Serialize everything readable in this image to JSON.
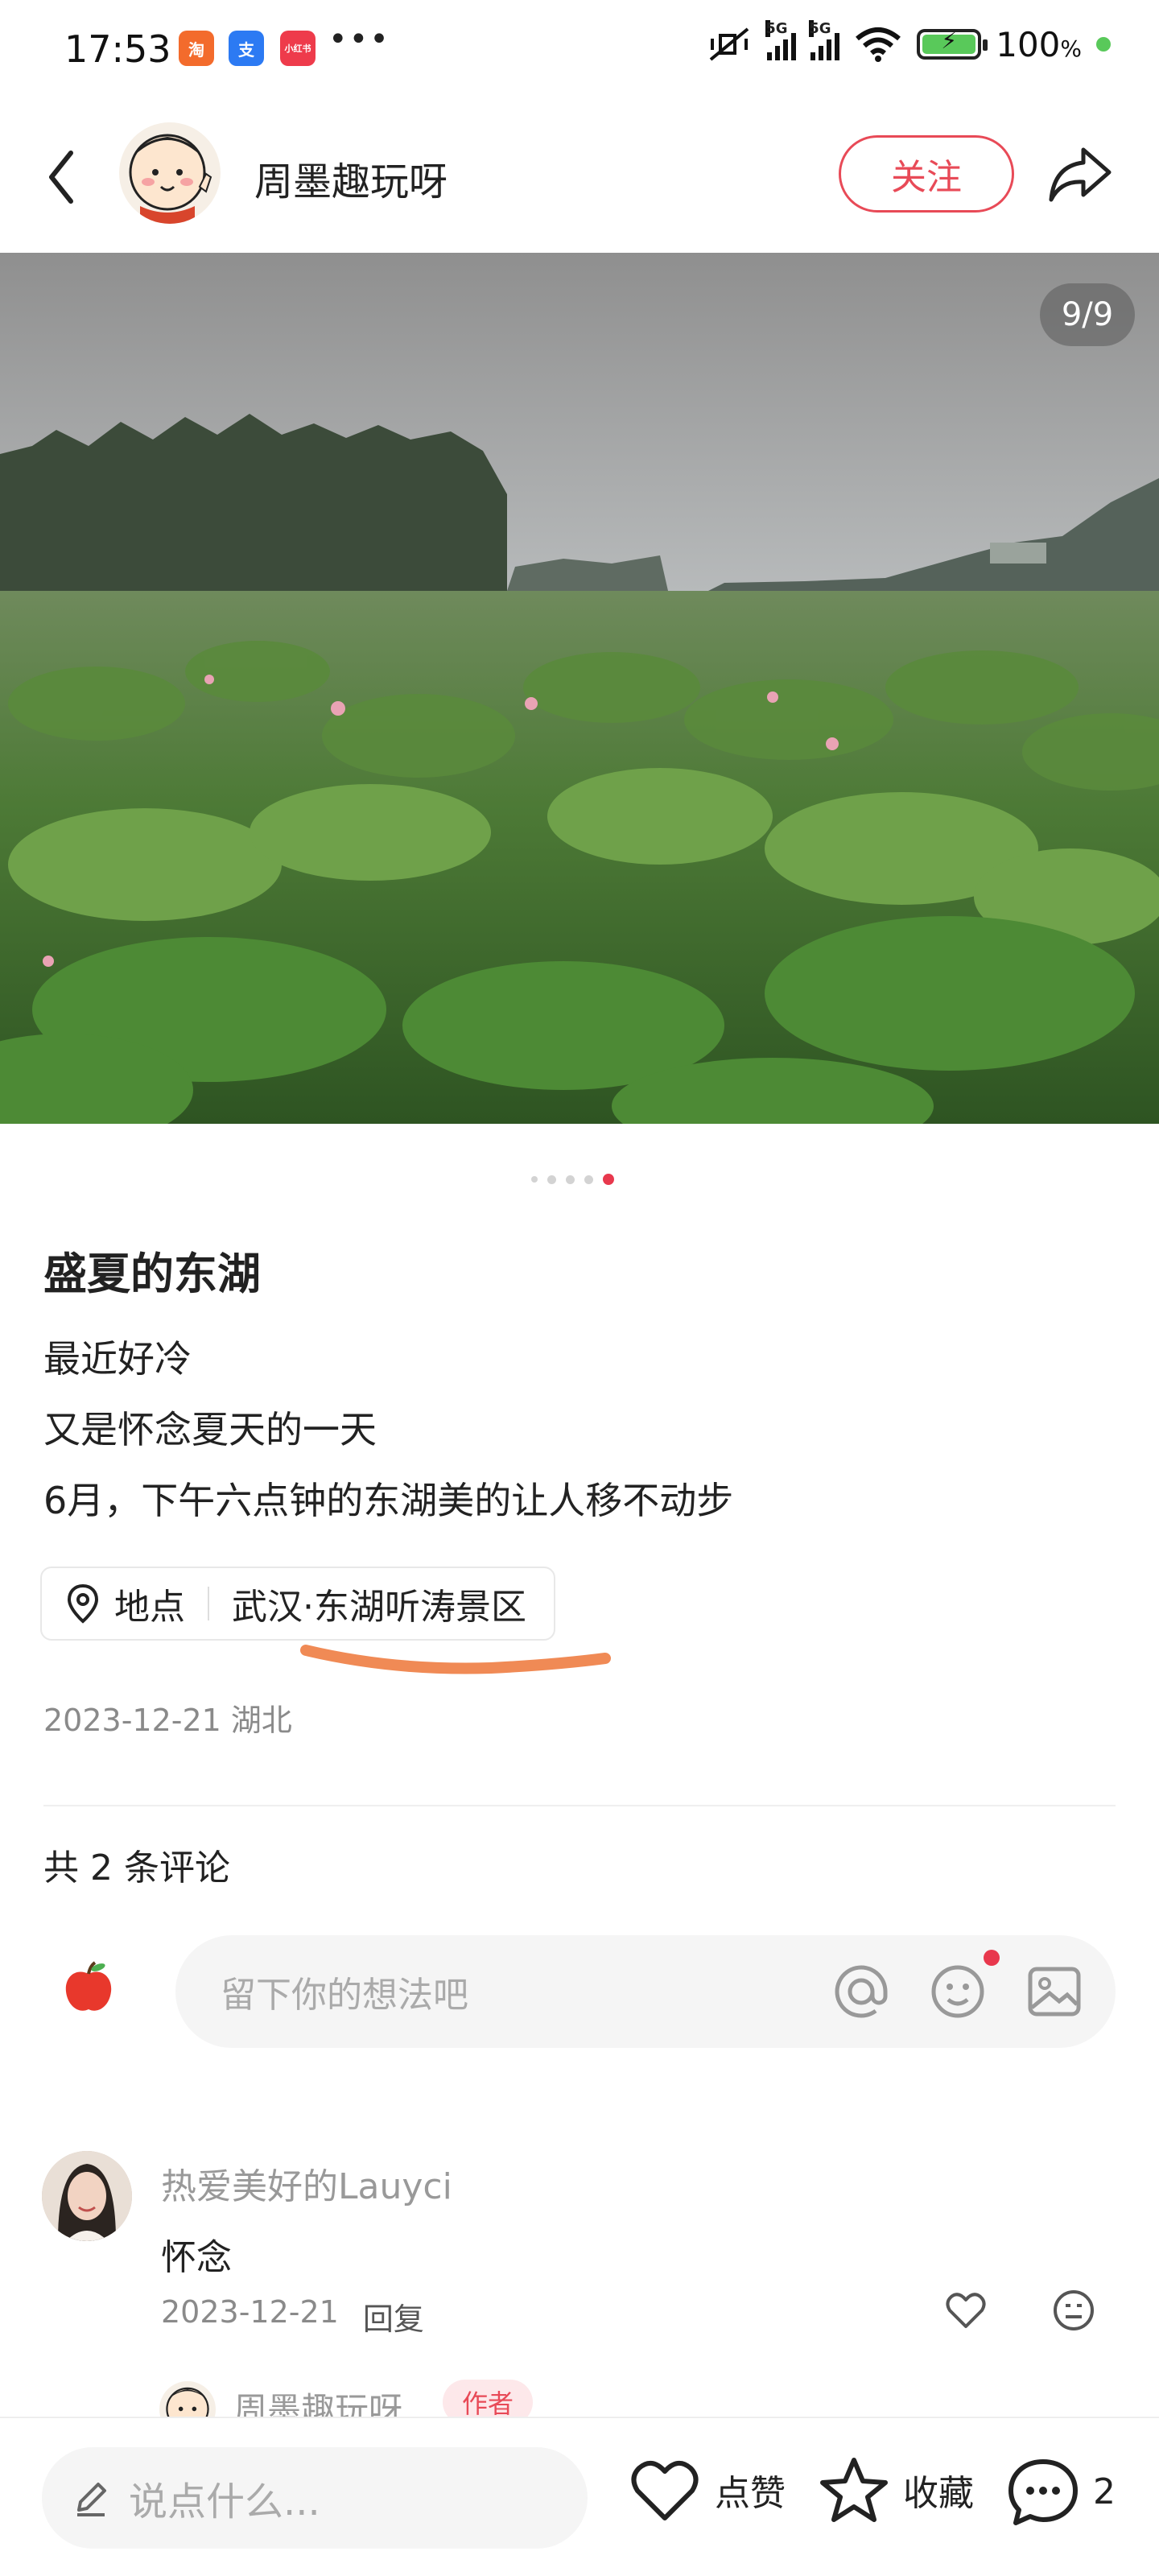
{
  "status_bar": {
    "time": "17:53",
    "apps": [
      {
        "label": "淘",
        "color": "#f36b2c"
      },
      {
        "label": "支",
        "color": "#2c7af3"
      },
      {
        "label": "小红书",
        "color": "#ee3b4b"
      }
    ],
    "more": "•••",
    "network_tags": [
      "5G",
      "5G"
    ],
    "battery_percent": "100",
    "battery_suffix": "%",
    "battery_level": 1.0
  },
  "header": {
    "author_name": "周墨趣玩呀",
    "follow_label": "关注"
  },
  "photo": {
    "page_indicator": "9/9",
    "dot_count": 5,
    "active_dot": 5
  },
  "post": {
    "title": "盛夏的东湖",
    "body_lines": [
      "最近好冷",
      "又是怀念夏天的一天",
      "6月，下午六点钟的东湖美的让人移不动步"
    ],
    "location_label": "地点",
    "location_value": "武汉·东湖听涛景区",
    "date_region": "2023-12-21 湖北"
  },
  "comments": {
    "count_label": "共 2 条评论",
    "input_placeholder": "留下你的想法吧",
    "items": [
      {
        "user": "热爱美好的Lauyci",
        "text": "怀念",
        "date": "2023-12-21",
        "reply_label": "回复"
      }
    ],
    "reply_preview": {
      "user": "周墨趣玩呀",
      "tag": "作者"
    }
  },
  "bottom_bar": {
    "input_placeholder": "说点什么...",
    "like_label": "点赞",
    "collect_label": "收藏",
    "comment_count": "2"
  },
  "colors": {
    "accent": "#e84a57",
    "highlight_stroke": "#f08a55"
  }
}
